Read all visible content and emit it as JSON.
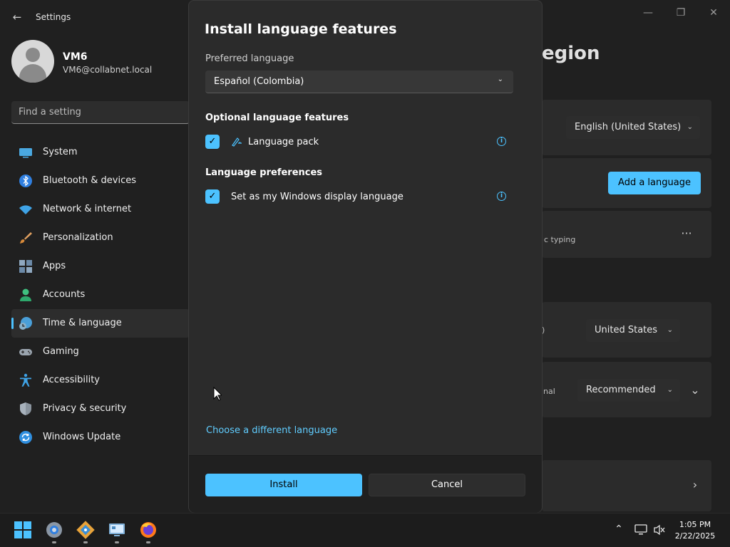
{
  "window": {
    "title": "Settings",
    "back_icon": "back-arrow-icon",
    "controls": [
      "minimize-icon",
      "maximize-icon",
      "close-icon"
    ]
  },
  "profile": {
    "name": "VM6",
    "email": "VM6@collabnet.local"
  },
  "search": {
    "placeholder": "Find a setting"
  },
  "sidebar": {
    "items": [
      {
        "label": "System",
        "icon": "system-icon"
      },
      {
        "label": "Bluetooth & devices",
        "icon": "bluetooth-icon"
      },
      {
        "label": "Network & internet",
        "icon": "network-icon"
      },
      {
        "label": "Personalization",
        "icon": "brush-icon"
      },
      {
        "label": "Apps",
        "icon": "apps-icon"
      },
      {
        "label": "Accounts",
        "icon": "accounts-icon"
      },
      {
        "label": "Time & language",
        "icon": "time-language-icon",
        "active": true
      },
      {
        "label": "Gaming",
        "icon": "gaming-icon"
      },
      {
        "label": "Accessibility",
        "icon": "accessibility-icon"
      },
      {
        "label": "Privacy & security",
        "icon": "shield-icon"
      },
      {
        "label": "Windows Update",
        "icon": "update-icon"
      }
    ]
  },
  "background": {
    "page_title_fragment": "egion",
    "windows_display_language": "English (United States)",
    "add_language_label": "Add a language",
    "typing_fragment": "c typing",
    "more_label": "···",
    "country_region": "United States",
    "regional_fragment": "nal",
    "regional_format": "Recommended",
    "paren_fragment": ")"
  },
  "dialog": {
    "title": "Install language features",
    "preferred_language_label": "Preferred language",
    "preferred_language_value": "Español (Colombia)",
    "optional_features_title": "Optional language features",
    "language_pack_label": "Language pack",
    "language_pack_checked": true,
    "preferences_title": "Language preferences",
    "display_language_label": "Set as my Windows display language",
    "display_language_checked": true,
    "choose_language_link": "Choose a different language",
    "install_label": "Install",
    "cancel_label": "Cancel"
  },
  "taskbar": {
    "apps": [
      "start-icon",
      "settings-app-icon",
      "git-app-icon",
      "remote-desktop-icon",
      "firefox-icon"
    ],
    "tray": [
      "chevron-up-icon",
      "network-tray-icon",
      "volume-muted-icon"
    ],
    "time": "1:05 PM",
    "date": "2/22/2025"
  },
  "colors": {
    "accent": "#4cc2ff",
    "link": "#60cdff",
    "background": "#202020",
    "dialog": "#2b2b2b"
  }
}
